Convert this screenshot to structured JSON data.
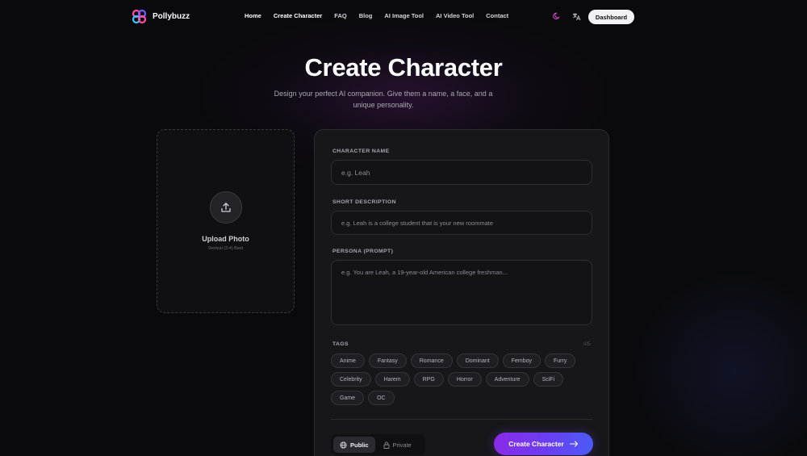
{
  "brand": {
    "name": "Pollybuzz",
    "accent": "#8a2be8",
    "accent2": "#4b5cf5"
  },
  "nav": {
    "links": [
      "Home",
      "Create Character",
      "FAQ",
      "Blog",
      "AI Image Tool",
      "AI Video Tool",
      "Contact"
    ],
    "theme_icon": "moon-icon",
    "language_icon": "translate-icon",
    "dashboard_label": "Dashboard"
  },
  "hero": {
    "title": "Create Character",
    "subtitle": "Design your perfect AI companion. Give them a name, a face, and a unique personality."
  },
  "upload": {
    "icon": "upload-icon",
    "label": "Upload Photo",
    "hint": "Vertical (3:4) Best"
  },
  "form": {
    "name_label": "Character Name",
    "name_placeholder": "e.g. Leah",
    "desc_label": "Short Description",
    "desc_placeholder": "e.g. Leah is a college student that is your new roommate",
    "persona_label": "Persona (Prompt)",
    "persona_placeholder": "e.g. You are Leah, a 19-year-old American college freshman...",
    "tags_label": "Tags",
    "tags_count": "0/5",
    "tags": [
      "Anime",
      "Fantasy",
      "Romance",
      "Dominant",
      "Femboy",
      "Furry",
      "Celebrity",
      "Harem",
      "RPG",
      "Horror",
      "Adventure",
      "SciFi",
      "Game",
      "OC"
    ],
    "visibility": {
      "public_label": "Public",
      "private_label": "Private",
      "selected": "Public"
    },
    "submit_label": "Create Character"
  }
}
